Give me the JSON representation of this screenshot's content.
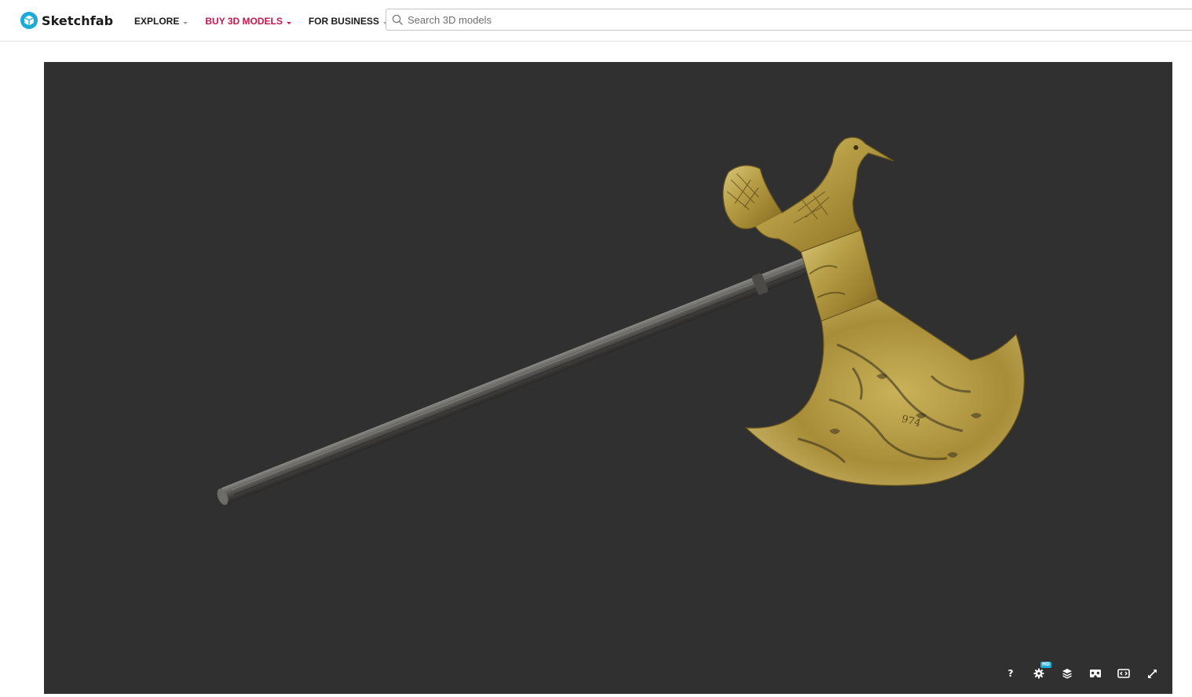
{
  "header": {
    "logo_text": "Sketchfab",
    "logo_color": "#1caad9",
    "nav": [
      {
        "label": "EXPLORE",
        "accent": false
      },
      {
        "label": "BUY 3D MODELS",
        "accent": true
      },
      {
        "label": "FOR BUSINESS",
        "accent": false
      }
    ],
    "accent_color": "#c8174c",
    "search": {
      "placeholder": "Search 3D models",
      "value": ""
    }
  },
  "viewer": {
    "background": "#303030",
    "model_subject": "engraved brass bird-topped axe",
    "controls": [
      {
        "name": "help-button",
        "icon": "question-icon",
        "label": "?"
      },
      {
        "name": "settings-button",
        "icon": "gear-icon",
        "badge": "HD"
      },
      {
        "name": "layers-button",
        "icon": "layers-icon"
      },
      {
        "name": "vr-button",
        "icon": "vr-headset-icon"
      },
      {
        "name": "embed-button",
        "icon": "embed-icon"
      },
      {
        "name": "fullscreen-button",
        "icon": "fullscreen-icon"
      }
    ]
  }
}
